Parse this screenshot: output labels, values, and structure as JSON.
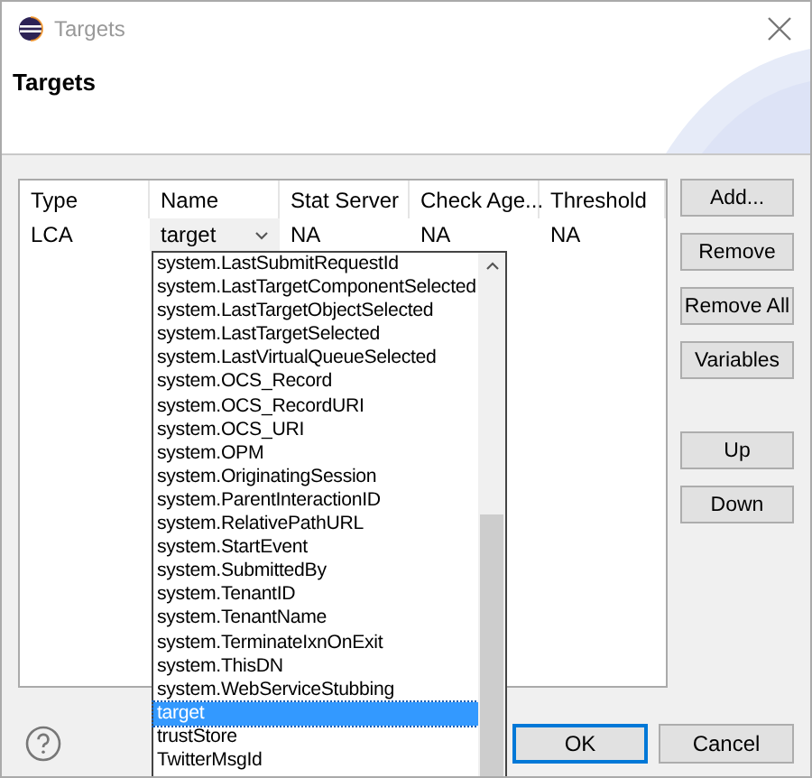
{
  "window": {
    "title": "Targets"
  },
  "header": {
    "title": "Targets"
  },
  "table": {
    "columns": [
      "Type",
      "Name",
      "Stat Server",
      "Check Age...",
      "Threshold"
    ],
    "rows": [
      {
        "type": "LCA",
        "name": "target",
        "stat_server": "NA",
        "check_age": "NA",
        "threshold": "NA"
      }
    ]
  },
  "dropdown": {
    "items": [
      {
        "label": "system.LastSubmitRequestId",
        "selected": false
      },
      {
        "label": "system.LastTargetComponentSelected",
        "selected": false
      },
      {
        "label": "system.LastTargetObjectSelected",
        "selected": false
      },
      {
        "label": "system.LastTargetSelected",
        "selected": false
      },
      {
        "label": "system.LastVirtualQueueSelected",
        "selected": false
      },
      {
        "label": "system.OCS_Record",
        "selected": false
      },
      {
        "label": "system.OCS_RecordURI",
        "selected": false
      },
      {
        "label": "system.OCS_URI",
        "selected": false
      },
      {
        "label": "system.OPM",
        "selected": false
      },
      {
        "label": "system.OriginatingSession",
        "selected": false
      },
      {
        "label": "system.ParentInteractionID",
        "selected": false
      },
      {
        "label": "system.RelativePathURL",
        "selected": false
      },
      {
        "label": "system.StartEvent",
        "selected": false
      },
      {
        "label": "system.SubmittedBy",
        "selected": false
      },
      {
        "label": "system.TenantID",
        "selected": false
      },
      {
        "label": "system.TenantName",
        "selected": false
      },
      {
        "label": "system.TerminateIxnOnExit",
        "selected": false
      },
      {
        "label": "system.ThisDN",
        "selected": false
      },
      {
        "label": "system.WebServiceStubbing",
        "selected": false
      },
      {
        "label": "target",
        "selected": true
      },
      {
        "label": "trustStore",
        "selected": false
      },
      {
        "label": "TwitterMsgId",
        "selected": false
      }
    ]
  },
  "side_buttons": [
    {
      "label": "Add..."
    },
    {
      "label": "Remove"
    },
    {
      "label": "Remove All"
    },
    {
      "label": "Variables"
    },
    {
      "label": "Up"
    },
    {
      "label": "Down"
    }
  ],
  "dialog_buttons": [
    {
      "label": "OK",
      "default": true
    },
    {
      "label": "Cancel",
      "default": false
    }
  ]
}
